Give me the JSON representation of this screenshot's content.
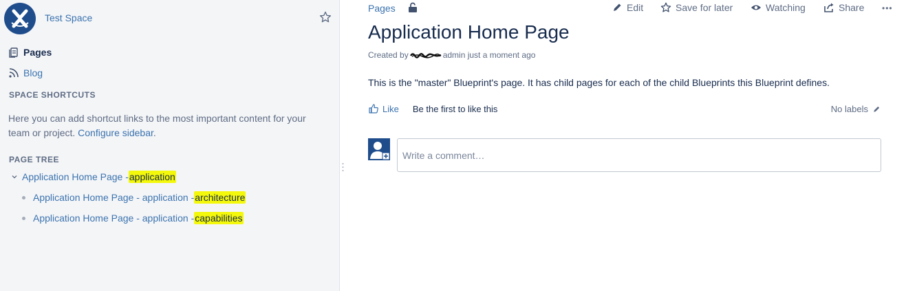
{
  "sidebar": {
    "space_name": "Test Space",
    "nav": {
      "pages": "Pages",
      "blog": "Blog"
    },
    "shortcuts_title": "SPACE SHORTCUTS",
    "shortcuts_text": "Here you can add shortcut links to the most important content for your team or project.",
    "configure_link": "Configure sidebar",
    "configure_suffix": ".",
    "tree_title": "PAGE TREE",
    "tree": {
      "root": {
        "prefix": "Application Home Page - ",
        "highlight": "application"
      },
      "children": [
        {
          "prefix": "Application Home Page - application - ",
          "highlight": "architecture"
        },
        {
          "prefix": "Application Home Page - application - ",
          "highlight": "capabilities"
        }
      ]
    }
  },
  "header": {
    "breadcrumb": "Pages",
    "actions": {
      "edit": "Edit",
      "save_later": "Save for later",
      "watching": "Watching",
      "share": "Share",
      "more": "•••"
    }
  },
  "page": {
    "title": "Application Home Page",
    "byline_prefix": "Created by",
    "byline_suffix": "admin just a moment ago",
    "body": "This is the \"master\" Blueprint's page. It has child pages for each of the child Blueprints this Blueprint defines.",
    "like_label": "Like",
    "like_message": "Be the first to like this",
    "labels_text": "No labels"
  },
  "comment": {
    "placeholder": "Write a comment…"
  },
  "colors": {
    "link": "#3b73af",
    "highlight": "#f4f80a",
    "sidebar_bg": "#f4f5f7",
    "logo_bg": "#1f4d8c"
  }
}
